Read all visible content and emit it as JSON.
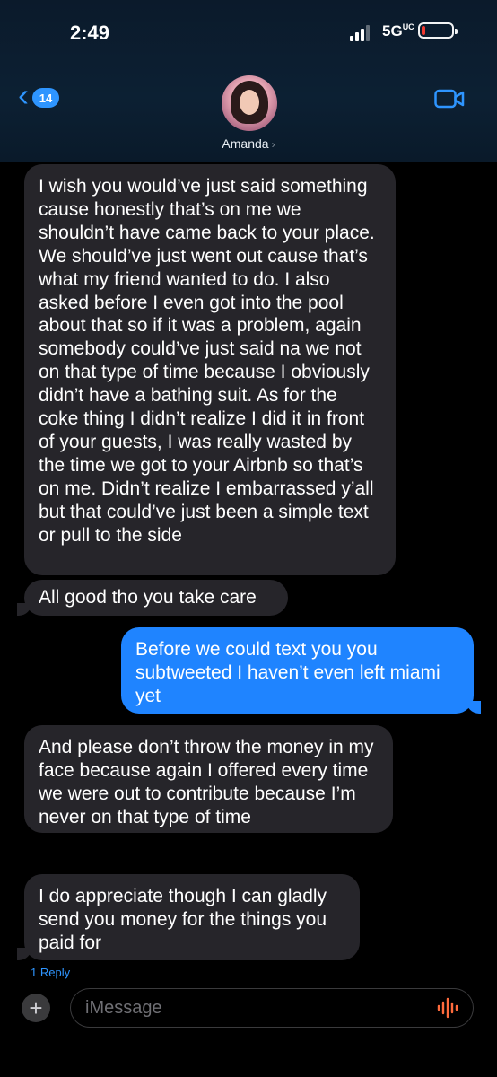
{
  "status_bar": {
    "time": "2:49",
    "network": "5G",
    "network_sub": "UC"
  },
  "nav": {
    "back_count": "14",
    "contact_name": "Amanda",
    "chevron": "›"
  },
  "messages": [
    {
      "direction": "incoming",
      "text": "I wish you would’ve just said something cause honestly that’s on me we shouldn’t have came back to your place. We should’ve just went out cause that’s what my friend wanted to do. I also asked before I even got into the pool about that so if it was a problem, again somebody could’ve just said na we not on that type of time because I obviously didn’t have a bathing suit. As for the coke thing I didn’t realize I did it in front of your guests, I was really wasted by the time we got to your Airbnb so that’s on me. Didn’t realize I embarrassed y’all but that could’ve just been a simple text or pull to the side"
    },
    {
      "direction": "incoming",
      "text": "All good tho you take care"
    },
    {
      "direction": "outgoing",
      "text": "Before we could text you you subtweeted I haven’t even left miami yet"
    },
    {
      "direction": "incoming",
      "text": "And please don’t throw the money in my face because again I offered every time we were out to contribute because I’m never on that type of time"
    },
    {
      "direction": "incoming",
      "text": "I do appreciate though I can gladly send you money for the things you paid for"
    }
  ],
  "reply_label": "1 Reply",
  "composer": {
    "plus": "+",
    "placeholder": "iMessage"
  },
  "colors": {
    "incoming_bubble": "#26252a",
    "outgoing_bubble": "#1f84ff",
    "accent": "#2e95ff",
    "battery_low": "#ff3b30"
  },
  "icons": [
    "back-chevron-icon",
    "video-camera-icon",
    "plus-icon",
    "audio-waveform-icon",
    "battery-icon",
    "signal-icon"
  ]
}
